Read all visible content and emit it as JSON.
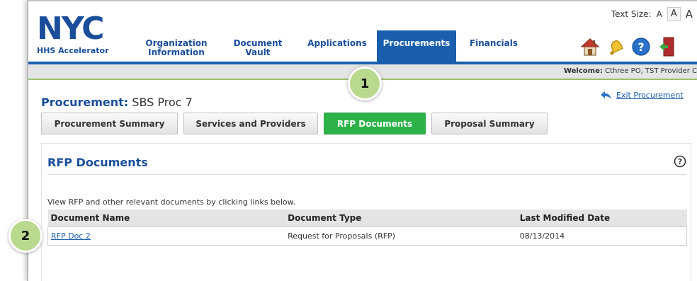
{
  "header": {
    "logo_text": "NYC",
    "logo_subtitle": "HHS Accelerator",
    "text_size_label": "Text Size:",
    "text_size_options": [
      "A",
      "A",
      "A"
    ]
  },
  "nav": {
    "tabs": [
      {
        "line1": "Organization",
        "line2": "Information"
      },
      {
        "line1": "Document",
        "line2": "Vault"
      },
      {
        "line1": "Applications",
        "line2": ""
      },
      {
        "line1": "Procurements",
        "line2": ""
      },
      {
        "line1": "Financials",
        "line2": ""
      }
    ],
    "active_tab": "Procurements",
    "icons": [
      "home-icon",
      "bell-icon",
      "help-icon",
      "logout-icon"
    ]
  },
  "welcome": {
    "label": "Welcome:",
    "user": "Cthree PO, TST Provider C"
  },
  "procurement": {
    "label": "Procurement:",
    "name": "SBS Proc 7",
    "exit_label": "Exit Procurement",
    "subtabs": [
      "Procurement Summary",
      "Services and Providers",
      "RFP Documents",
      "Proposal Summary"
    ],
    "active_subtab": "RFP Documents"
  },
  "rfp": {
    "title": "RFP Documents",
    "instruction": "View RFP and other relevant documents by clicking links below.",
    "columns": [
      "Document Name",
      "Document Type",
      "Last Modified Date"
    ],
    "rows": [
      {
        "name": "RFP Doc 2",
        "type": "Request for Proposals (RFP)",
        "modified": "08/13/2014"
      }
    ]
  },
  "callouts": [
    "1",
    "2"
  ],
  "colors": {
    "brand_blue": "#1a5fae",
    "active_green": "#2db34a",
    "callout_green": "#b9d98e"
  }
}
